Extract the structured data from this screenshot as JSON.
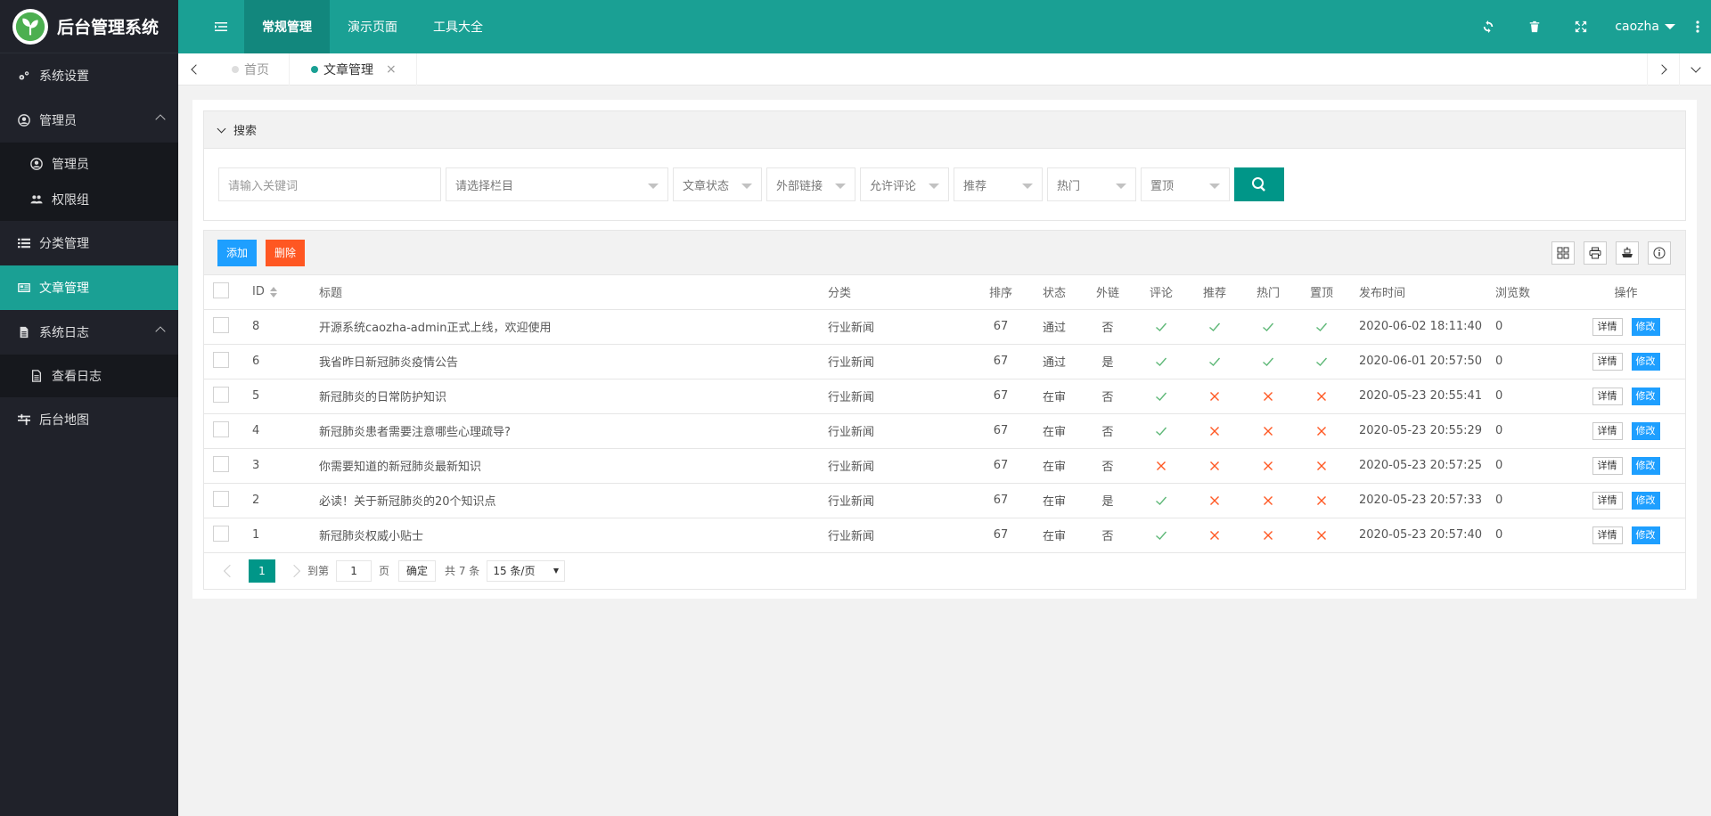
{
  "app": {
    "title": "后台管理系统"
  },
  "sidebar": {
    "items": [
      {
        "label": "系统设置",
        "icon": "gears-icon"
      },
      {
        "label": "管理员",
        "icon": "user-circle-icon",
        "children": [
          {
            "label": "管理员",
            "icon": "user-circle-icon"
          },
          {
            "label": "权限组",
            "icon": "users-icon"
          }
        ]
      },
      {
        "label": "分类管理",
        "icon": "list-icon"
      },
      {
        "label": "文章管理",
        "icon": "newspaper-icon",
        "active": true
      },
      {
        "label": "系统日志",
        "icon": "file-icon",
        "children": [
          {
            "label": "查看日志",
            "icon": "file-text-icon"
          }
        ]
      },
      {
        "label": "后台地图",
        "icon": "sitemap-icon"
      }
    ]
  },
  "header": {
    "menu": [
      "常规管理",
      "演示页面",
      "工具大全"
    ],
    "active_menu": "常规管理",
    "user": "caozha"
  },
  "tabs": [
    {
      "label": "首页"
    },
    {
      "label": "文章管理",
      "close": "×"
    }
  ],
  "search": {
    "title": "搜索",
    "keyword_placeholder": "请输入关键词",
    "column_placeholder": "请选择栏目",
    "filters": [
      "文章状态",
      "外部链接",
      "允许评论",
      "推荐",
      "热门",
      "置顶"
    ]
  },
  "toolbar": {
    "add": "添加",
    "delete": "删除"
  },
  "table": {
    "headers": [
      "ID",
      "标题",
      "分类",
      "排序",
      "状态",
      "外链",
      "评论",
      "推荐",
      "热门",
      "置顶",
      "发布时间",
      "浏览数",
      "操作"
    ],
    "detail_label": "详情",
    "edit_label": "修改",
    "rows": [
      {
        "id": "8",
        "title": "开源系统caozha-admin正式上线，欢迎使用",
        "category": "行业新闻",
        "sort": "67",
        "status": "通过",
        "link": "否",
        "comment": true,
        "recommend": true,
        "hot": true,
        "top": true,
        "time": "2020-06-02 18:11:40",
        "views": "0"
      },
      {
        "id": "6",
        "title": "我省昨日新冠肺炎疫情公告",
        "category": "行业新闻",
        "sort": "67",
        "status": "通过",
        "link": "是",
        "comment": true,
        "recommend": true,
        "hot": true,
        "top": true,
        "time": "2020-06-01 20:57:50",
        "views": "0"
      },
      {
        "id": "5",
        "title": "新冠肺炎的日常防护知识",
        "category": "行业新闻",
        "sort": "67",
        "status": "在审",
        "link": "否",
        "comment": true,
        "recommend": false,
        "hot": false,
        "top": false,
        "time": "2020-05-23 20:55:41",
        "views": "0"
      },
      {
        "id": "4",
        "title": "新冠肺炎患者需要注意哪些心理疏导?",
        "category": "行业新闻",
        "sort": "67",
        "status": "在审",
        "link": "否",
        "comment": true,
        "recommend": false,
        "hot": false,
        "top": false,
        "time": "2020-05-23 20:55:29",
        "views": "0"
      },
      {
        "id": "3",
        "title": "你需要知道的新冠肺炎最新知识",
        "category": "行业新闻",
        "sort": "67",
        "status": "在审",
        "link": "否",
        "comment": false,
        "recommend": false,
        "hot": false,
        "top": false,
        "time": "2020-05-23 20:57:25",
        "views": "0"
      },
      {
        "id": "2",
        "title": "必读！关于新冠肺炎的20个知识点",
        "category": "行业新闻",
        "sort": "67",
        "status": "在审",
        "link": "是",
        "comment": true,
        "recommend": false,
        "hot": false,
        "top": false,
        "time": "2020-05-23 20:57:33",
        "views": "0"
      },
      {
        "id": "1",
        "title": "新冠肺炎权威小贴士",
        "category": "行业新闻",
        "sort": "67",
        "status": "在审",
        "link": "否",
        "comment": true,
        "recommend": false,
        "hot": false,
        "top": false,
        "time": "2020-05-23 20:57:40",
        "views": "0"
      }
    ]
  },
  "pagination": {
    "current": "1",
    "goto_label": "到第",
    "page_input": "1",
    "page_label": "页",
    "confirm": "确定",
    "total": "共 7 条",
    "page_size": "15 条/页"
  },
  "colors": {
    "primary": "#1aa094",
    "sidebar": "#20222a",
    "blue": "#1e9fff",
    "orange": "#ff5722",
    "check": "#5fb878"
  }
}
